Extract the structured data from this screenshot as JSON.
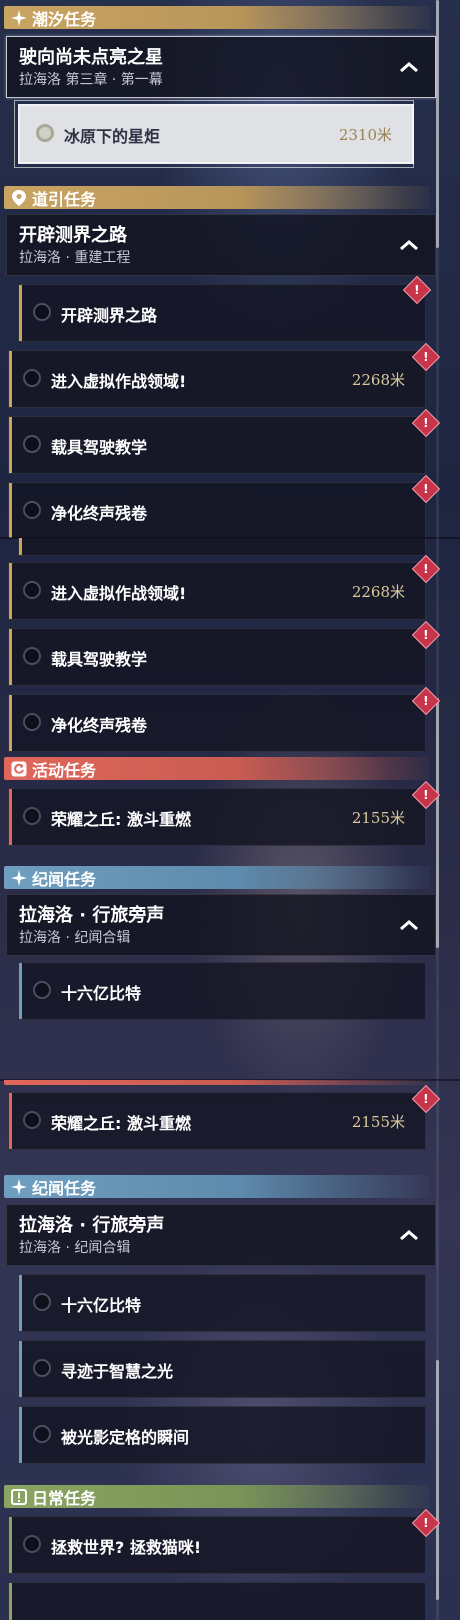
{
  "distance_unit": "米",
  "colors": {
    "gold": "#c9a562",
    "red": "#e0675a",
    "blue": "#6f9fc0",
    "green": "#8aa463",
    "warning": "#c8344a"
  },
  "panel1": {
    "tide_header": "潮汐任务",
    "tide_group": {
      "title": "驶向尚未点亮之星",
      "subtitle": "拉海洛 第三章 · 第一幕"
    },
    "tide_quest": {
      "title": "冰原下的星炬",
      "distance": "2310米"
    },
    "guide_header": "道引任务",
    "guide_group": {
      "title": "开辟测界之路",
      "subtitle": "拉海洛 · 重建工程"
    },
    "quests": [
      {
        "title": "开辟测界之路",
        "distance": ""
      },
      {
        "title": "进入虚拟作战领域!",
        "distance": "2268米"
      },
      {
        "title": "载具驾驶教学",
        "distance": ""
      },
      {
        "title": "净化终声残卷",
        "distance": ""
      }
    ],
    "warning_glyph": "!"
  },
  "panel2": {
    "quests": [
      {
        "title": "进入虚拟作战领域!",
        "distance": "2268米"
      },
      {
        "title": "载具驾驶教学",
        "distance": ""
      },
      {
        "title": "净化终声残卷",
        "distance": ""
      }
    ],
    "event_header": "活动任务",
    "event_quest": {
      "title": "荣耀之丘: 激斗重燃",
      "distance": "2155米"
    },
    "lore_header": "纪闻任务",
    "lore_group": {
      "title": "拉海洛 · 行旅旁声",
      "subtitle": "拉海洛 · 纪闻合辑"
    },
    "lore_quest": {
      "title": "十六亿比特",
      "distance": ""
    }
  },
  "panel3": {
    "event_quest": {
      "title": "荣耀之丘: 激斗重燃",
      "distance": "2155米"
    },
    "lore_header": "纪闻任务",
    "lore_group": {
      "title": "拉海洛 · 行旅旁声",
      "subtitle": "拉海洛 · 纪闻合辑"
    },
    "lore_quests": [
      {
        "title": "十六亿比特"
      },
      {
        "title": "寻迹于智慧之光"
      },
      {
        "title": "被光影定格的瞬间"
      }
    ],
    "daily_header": "日常任务",
    "daily_quest": {
      "title": "拯救世界? 拯救猫咪!"
    }
  }
}
